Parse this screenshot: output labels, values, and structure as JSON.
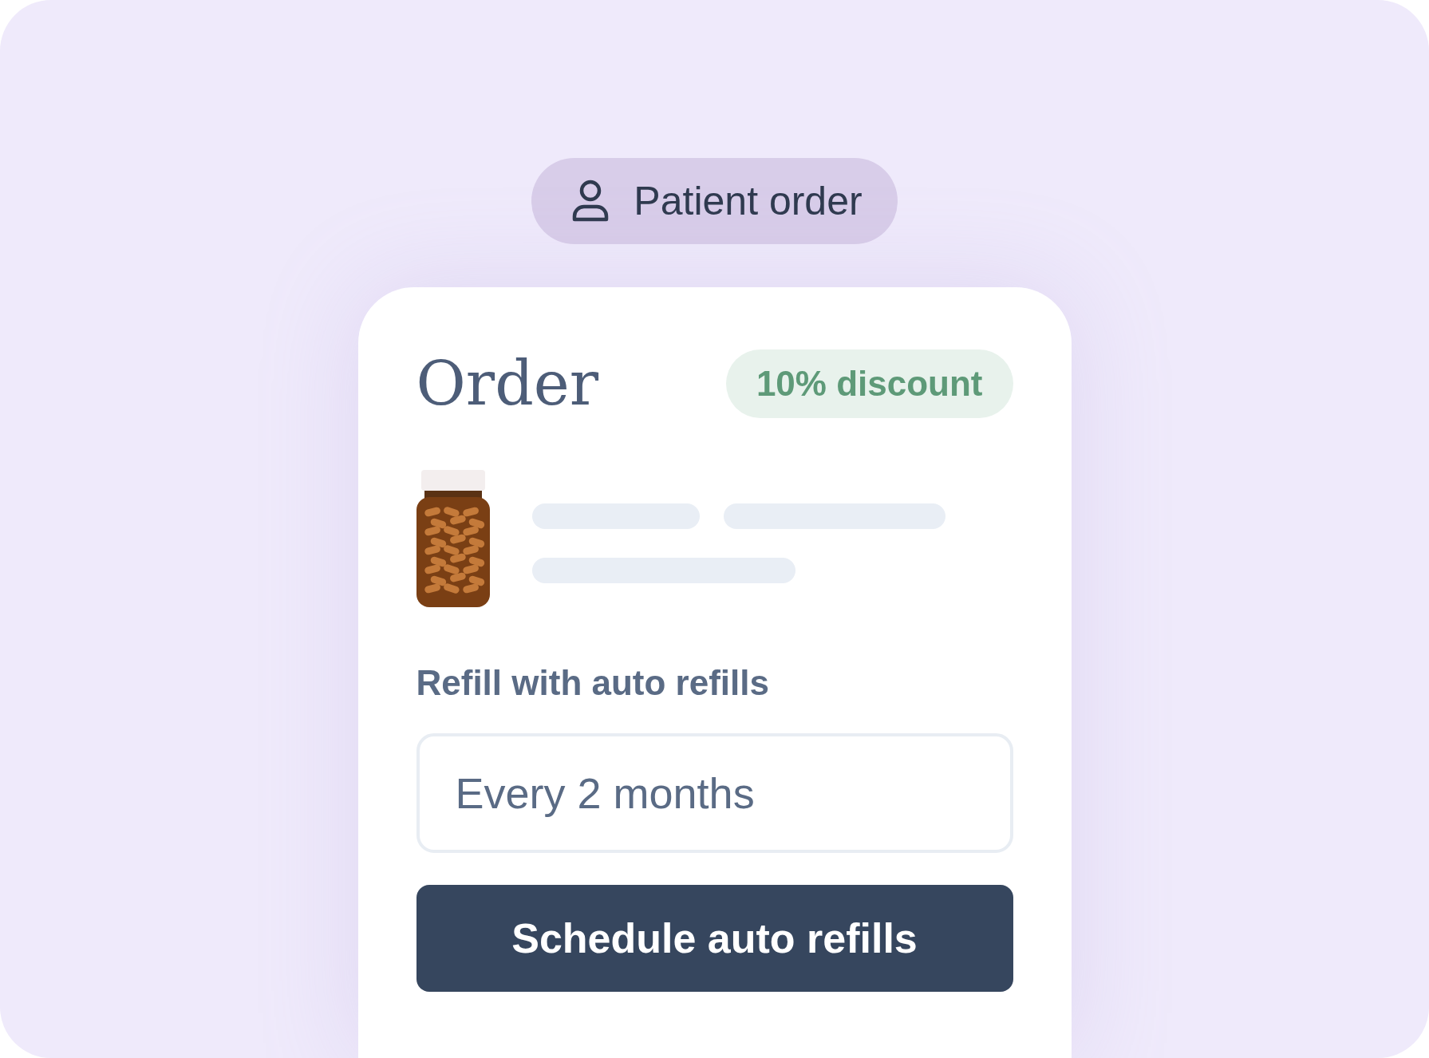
{
  "badge": {
    "label": "Patient order"
  },
  "order": {
    "title": "Order",
    "discount": "10% discount",
    "refill_label": "Refill with auto refills",
    "frequency_field": {
      "value": "Every 2 months"
    },
    "button": "Schedule auto refills"
  }
}
